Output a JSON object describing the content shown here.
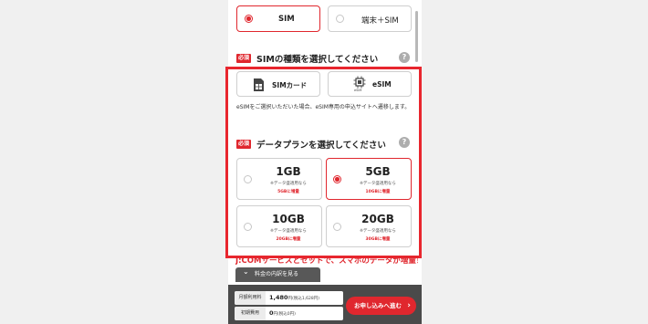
{
  "contract_type": {
    "options": [
      {
        "label": "SIM",
        "selected": true
      },
      {
        "label": "端末＋SIM",
        "selected": false
      }
    ]
  },
  "sim_type": {
    "badge": "必須",
    "title": "SIMの種類を選択してください",
    "help": "?",
    "options": [
      {
        "label": "SIMカード",
        "icon": "sim-card-icon"
      },
      {
        "label": "eSIM",
        "icon": "esim-chip-icon",
        "icon_caption": "eSIM"
      }
    ],
    "note": "eSIMをご選択いただいた場合、eSIM専用の申込サイトへ遷移します。"
  },
  "data_plan": {
    "badge": "必須",
    "title": "データプランを選択してください",
    "help": "?",
    "plans": [
      {
        "gb": "1GB",
        "sub": "※データ盛適用なら",
        "bonus": "5GBに増量",
        "selected": false
      },
      {
        "gb": "5GB",
        "sub": "※データ盛適用なら",
        "bonus": "10GBに増量",
        "selected": true
      },
      {
        "gb": "10GB",
        "sub": "※データ盛適用なら",
        "bonus": "20GBに増量",
        "selected": false
      },
      {
        "gb": "20GB",
        "sub": "※データ盛適用なら",
        "bonus": "30GBに増量",
        "selected": false
      }
    ]
  },
  "promo": {
    "text": "J:COMサービスとセットで、スマホのデータが増量！"
  },
  "breakdown": {
    "label": "料金の内訳を見る",
    "chevron": "⌄"
  },
  "fees": {
    "monthly": {
      "label": "月額利用料",
      "value": "1,480",
      "unit": "円",
      "tax": "(税込1,628円)"
    },
    "initial": {
      "label": "初期費用",
      "value": "0",
      "unit": "円",
      "tax": "(税込0円)"
    }
  },
  "apply": {
    "label": "お申し込みへ進む",
    "chevron": "›"
  },
  "colors": {
    "accent": "#e0272e",
    "bar": "#4a4a4a"
  }
}
